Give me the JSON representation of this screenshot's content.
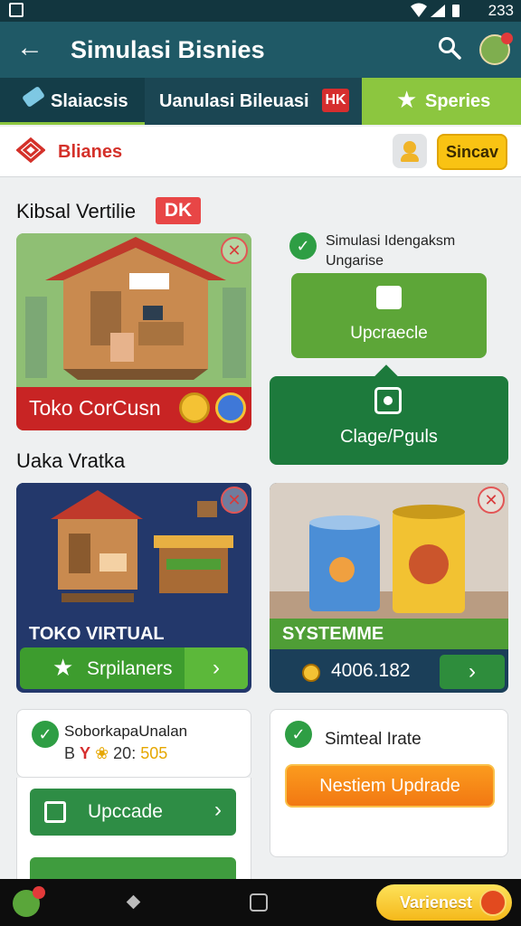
{
  "status": {
    "time": "233"
  },
  "appbar": {
    "title": "Simulasi Bisnies",
    "back_icon": "arrow-left-icon",
    "search_icon": "search-icon"
  },
  "tabs": [
    {
      "label": "Slaiacsis",
      "icon": "eraser-icon"
    },
    {
      "label": "Uanulasi Bileuasi",
      "badge": "HK"
    },
    {
      "label": "Speries",
      "icon": "star-icon"
    }
  ],
  "brand": {
    "name": "Blianes",
    "sync_label": "Sincav"
  },
  "section1": {
    "title": "Kibsal Vertilie",
    "badge": "DK"
  },
  "card_office": {
    "caption": "Toko CorCusn"
  },
  "right_panel": {
    "check_text_line1": "Simulasi Idengaksm",
    "check_text_line2": "Ungarise",
    "upgrade_label": "Upcraecle",
    "dark_label": "Clage/Pguls"
  },
  "section2": {
    "title": "Uaka Vratka"
  },
  "card_virtual": {
    "label": "TOKO VIRTUAL",
    "button_label": "Srpilaners"
  },
  "card_system": {
    "label": "SYSTEMME",
    "value": "4006.182"
  },
  "card_support": {
    "title": "SoborkapaUnalan",
    "line2_prefix": "B",
    "line2_red": "Y",
    "line2_mid": "20:",
    "line2_yellow": "505",
    "button_label": "Upccade"
  },
  "card_special": {
    "title": "Simteal Irate",
    "button_label": "Nestiem Updrade"
  },
  "navbar": {
    "button_label": "Varienest"
  },
  "colors": {
    "primary": "#1f5966",
    "accent_green": "#8cc63f",
    "red": "#d62e2e",
    "orange": "#f27812"
  }
}
